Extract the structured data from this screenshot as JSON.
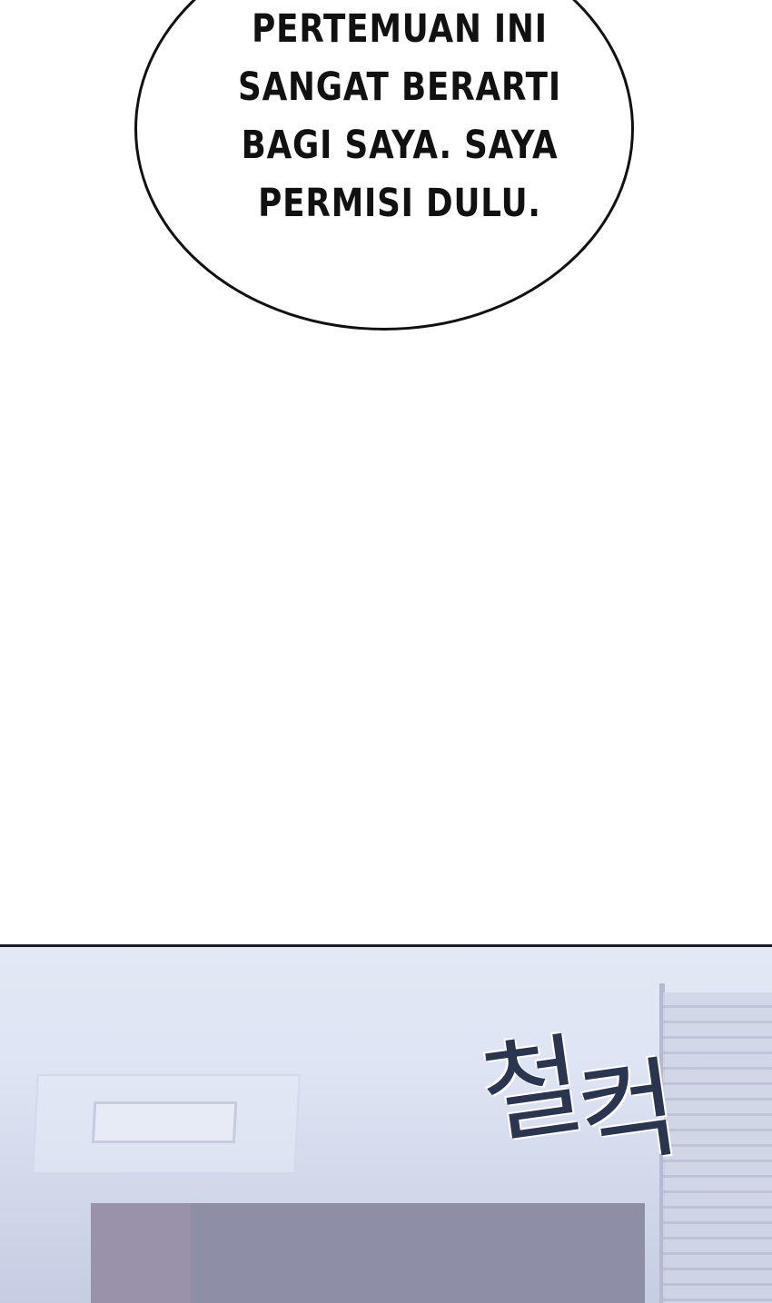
{
  "speech_bubble": {
    "lines": [
      "PERTEMUAN INI",
      "SANGAT BERARTI",
      "BAGI SAYA. SAYA",
      "PERMISI DULU."
    ]
  },
  "panel": {
    "sound_effect": [
      "철",
      "컥"
    ]
  },
  "colors": {
    "bubble_border": "#111111",
    "panel_top": "#e2e9f5",
    "panel_bottom": "#c6cde3",
    "sfx_ink": "#2a3550"
  }
}
